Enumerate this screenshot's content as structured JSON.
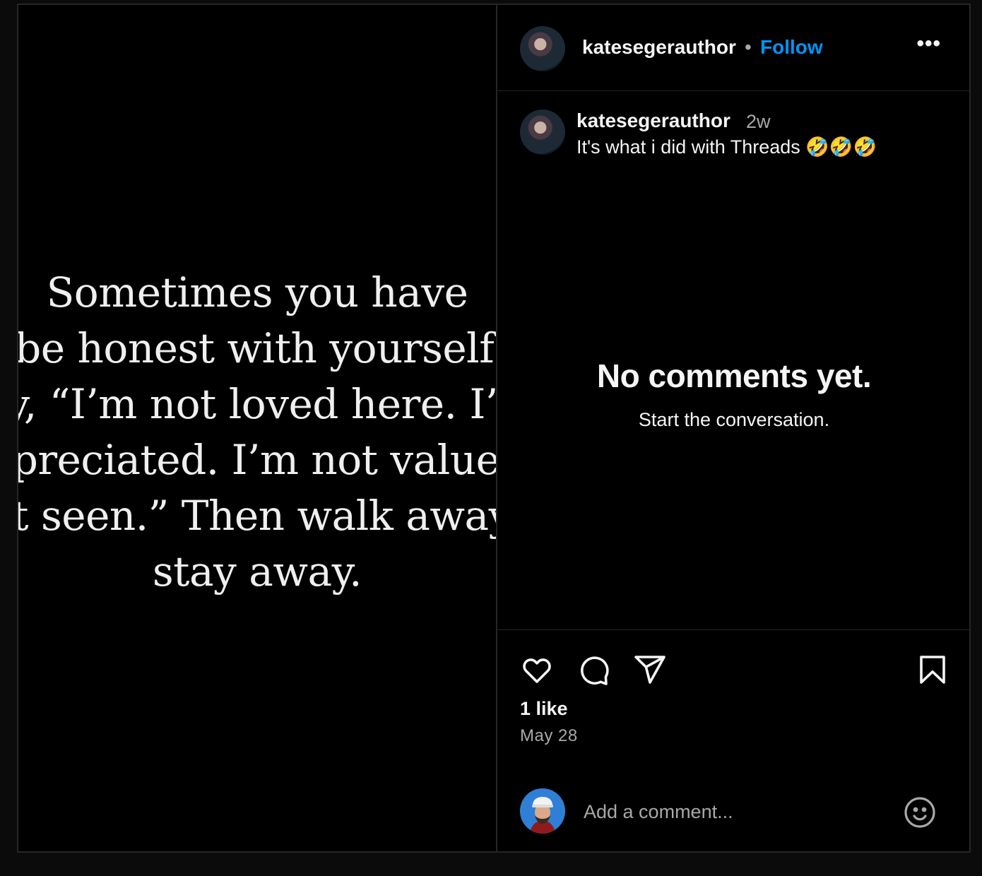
{
  "post": {
    "quote_lines": [
      "Sometimes you have",
      "to be honest with yourself and",
      "say, “I’m not loved here. I’m not",
      "appreciated. I’m not valued. I’m",
      "not seen.” Then walk away, and",
      "stay away."
    ]
  },
  "header": {
    "username": "katesegerauthor",
    "separator": "•",
    "follow_label": "Follow",
    "more_label": "•••"
  },
  "caption": {
    "username": "katesegerauthor",
    "time": "2w",
    "text": "It's what i did with Threads 🤣🤣🤣"
  },
  "comments": {
    "empty_title": "No comments yet.",
    "empty_subtitle": "Start the conversation."
  },
  "actions": {
    "icons": [
      "heart-icon",
      "comment-icon",
      "share-icon",
      "bookmark-icon"
    ],
    "likes": "1 like",
    "date": "May 28"
  },
  "comment_box": {
    "placeholder": "Add a comment...",
    "emoji_icon": "smiley-icon"
  },
  "colors": {
    "background": "#000000",
    "accent": "#0095f6",
    "muted": "#a8a8a8",
    "divider": "#262626"
  }
}
